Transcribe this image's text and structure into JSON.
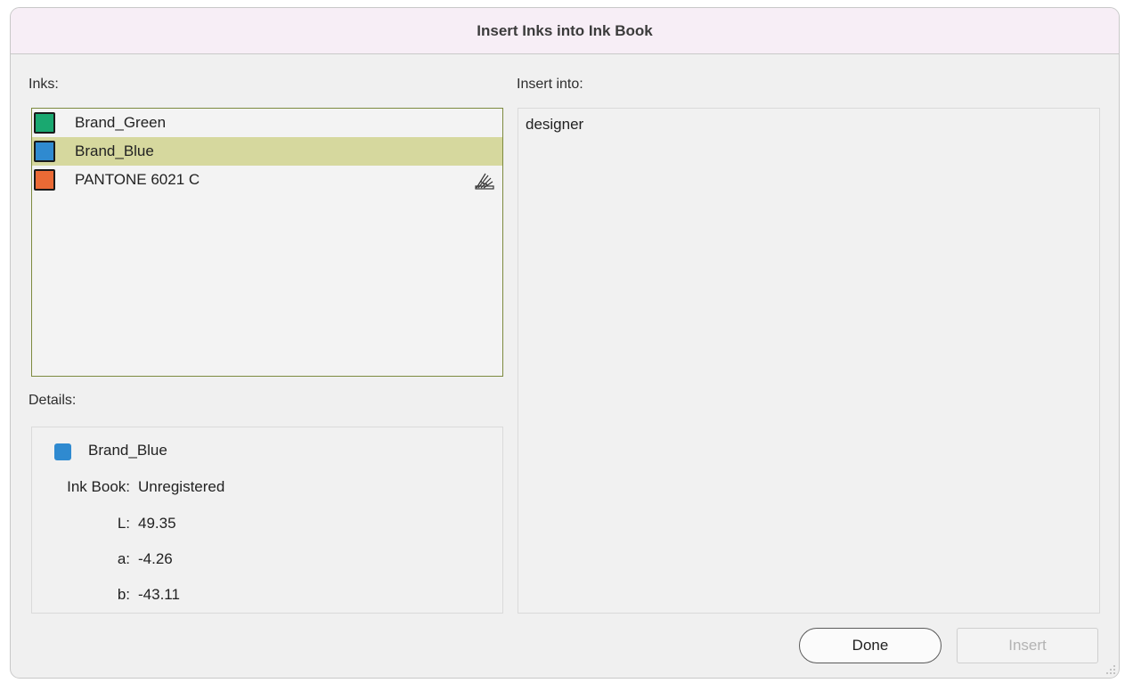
{
  "window": {
    "title": "Insert Inks into Ink Book"
  },
  "inks": {
    "label": "Inks:",
    "items": [
      {
        "name": "Brand_Green",
        "color": "#1aa870",
        "selected": false,
        "icon": ""
      },
      {
        "name": "Brand_Blue",
        "color": "#2f8ad0",
        "selected": true,
        "icon": ""
      },
      {
        "name": "PANTONE 6021 C",
        "color": "#ea6a35",
        "selected": false,
        "icon": "ink-book-icon"
      }
    ]
  },
  "insert_into": {
    "label": "Insert into:",
    "items": [
      "designer"
    ]
  },
  "details": {
    "label": "Details:",
    "name": "Brand_Blue",
    "color": "#2f8ad0",
    "ink_book_label": "Ink Book:",
    "ink_book_value": "Unregistered",
    "l_label": "L:",
    "l_value": "49.35",
    "a_label": "a:",
    "a_value": "-4.26",
    "b_label": "b:",
    "b_value": "-43.11"
  },
  "buttons": {
    "done": "Done",
    "insert": "Insert"
  },
  "colors": {
    "selection": "#d6d89e",
    "list_border": "#7d8a3f",
    "titlebar": "#f7eef6"
  }
}
